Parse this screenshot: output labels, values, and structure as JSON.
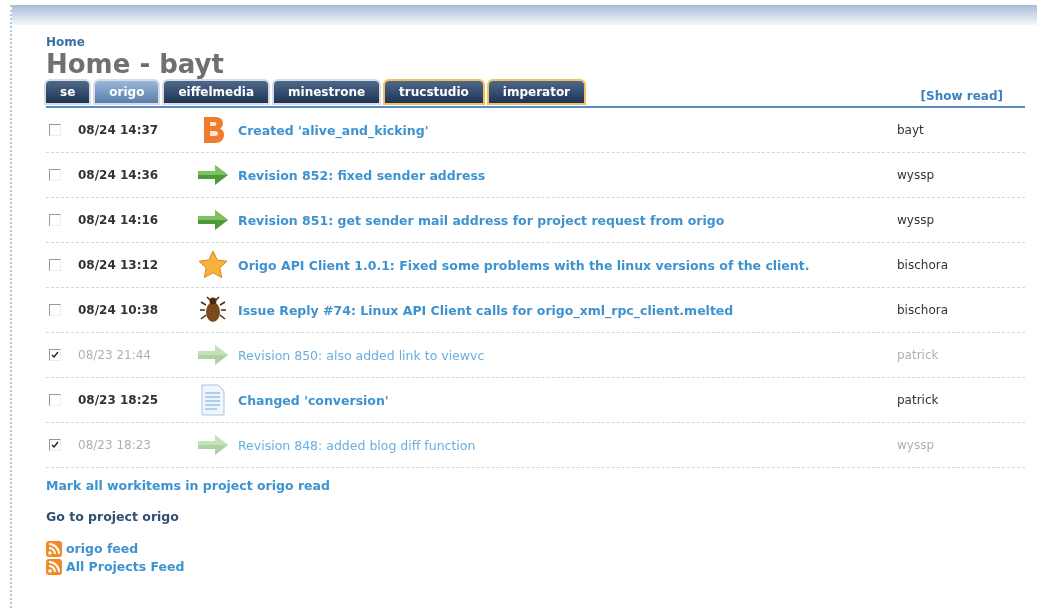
{
  "breadcrumb": "Home",
  "title": "Home - bayt",
  "tabs": [
    {
      "label": "se",
      "selected": false,
      "highlighted": false
    },
    {
      "label": "origo",
      "selected": true,
      "highlighted": false
    },
    {
      "label": "eiffelmedia",
      "selected": false,
      "highlighted": false
    },
    {
      "label": "minestrone",
      "selected": false,
      "highlighted": false
    },
    {
      "label": "trucstudio",
      "selected": false,
      "highlighted": true
    },
    {
      "label": "imperator",
      "selected": false,
      "highlighted": true
    }
  ],
  "show_read": "[Show read]",
  "workitems": [
    {
      "checked": false,
      "time": "08/24 14:37",
      "kind": "blog",
      "title": "Created 'alive_and_kicking'",
      "user": "bayt"
    },
    {
      "checked": false,
      "time": "08/24 14:36",
      "kind": "revision",
      "title": "Revision 852: fixed sender address",
      "user": "wyssp"
    },
    {
      "checked": false,
      "time": "08/24 14:16",
      "kind": "revision",
      "title": "Revision 851: get sender mail address for project request from origo",
      "user": "wyssp"
    },
    {
      "checked": false,
      "time": "08/24 13:12",
      "kind": "release",
      "title": "Origo API Client 1.0.1: Fixed some problems with the linux versions of the client.",
      "user": "bischora"
    },
    {
      "checked": false,
      "time": "08/24 10:38",
      "kind": "issue",
      "title": "Issue Reply #74: Linux API Client calls for origo_xml_rpc_client.melted",
      "user": "bischora"
    },
    {
      "checked": true,
      "time": "08/23 21:44",
      "kind": "revision",
      "title": "Revision 850: also added link to viewvc",
      "user": "patrick"
    },
    {
      "checked": false,
      "time": "08/23 18:25",
      "kind": "wiki",
      "title": "Changed 'conversion'",
      "user": "patrick"
    },
    {
      "checked": true,
      "time": "08/23 18:23",
      "kind": "revision",
      "title": "Revision 848: added blog diff function",
      "user": "wyssp"
    }
  ],
  "mark_all_link": "Mark all workitems in project origo read",
  "project_link": "Go to project origo",
  "feeds": [
    "origo feed",
    "All Projects Feed"
  ]
}
